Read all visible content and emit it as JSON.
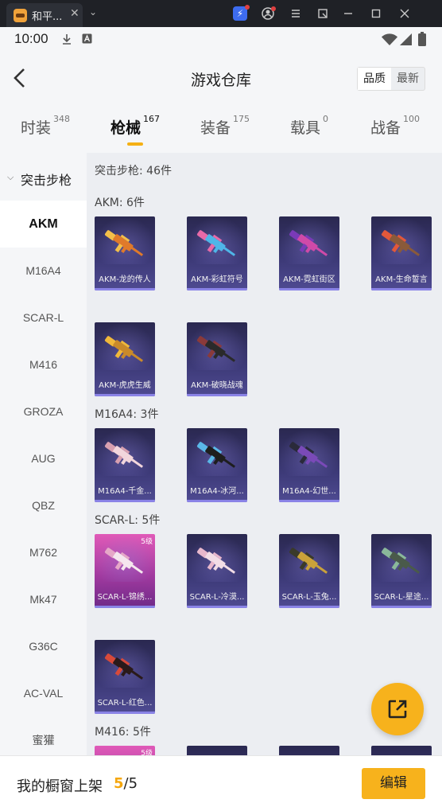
{
  "browser": {
    "tab_title": "和平...",
    "tab_close": "✕",
    "tab_dropdown": "⌄"
  },
  "status": {
    "time": "10:00"
  },
  "header": {
    "title": "游戏仓库",
    "sort_options": [
      "品质",
      "最新"
    ],
    "selected_sort": "品质"
  },
  "tabs": [
    {
      "label": "时装",
      "count": "348"
    },
    {
      "label": "枪械",
      "count": "167"
    },
    {
      "label": "装备",
      "count": "175"
    },
    {
      "label": "载具",
      "count": "0"
    },
    {
      "label": "战备",
      "count": "100"
    }
  ],
  "active_tab": "枪械",
  "sidebar": {
    "category": "突击步枪",
    "items": [
      "AKM",
      "M16A4",
      "SCAR-L",
      "M416",
      "GROZA",
      "AUG",
      "QBZ",
      "M762",
      "Mk47",
      "G36C",
      "AC-VAL",
      "蜜獾"
    ],
    "active": "AKM"
  },
  "content": {
    "summary": "突击步枪: 46件",
    "sections": [
      {
        "title": "AKM: 6件",
        "items": [
          "AKM-龙的传人",
          "AKM-彩虹符号",
          "AKM-霓虹街区",
          "AKM-生命誓言",
          "AKM-虎虎生威",
          "AKM-破晓战魂"
        ]
      },
      {
        "title": "M16A4: 3件",
        "items": [
          "M16A4-千金...",
          "M16A4-冰河...",
          "M16A4-幻世..."
        ]
      },
      {
        "title": "SCAR-L: 5件",
        "items": [
          "SCAR-L-锦绣...",
          "SCAR-L-冷漠...",
          "SCAR-L-玉兔...",
          "SCAR-L-星途...",
          "SCAR-L-红色..."
        ],
        "badge": "5级"
      },
      {
        "title": "M416: 5件",
        "badge": "5级"
      }
    ]
  },
  "bottom": {
    "label": "我的橱窗上架",
    "current": "5",
    "total": "/5",
    "edit_label": "编辑"
  },
  "colors": {
    "accent": "#f7b21c",
    "card": "#3d3a78",
    "card_epic": "#c24aaa"
  }
}
